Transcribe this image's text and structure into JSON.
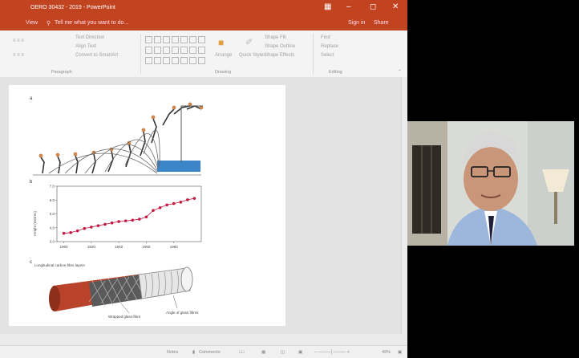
{
  "app": {
    "window_title": "OERO 30432 - 2019 - PowerPoint",
    "sign_in": "Sign in",
    "share": "Share",
    "tabs": [
      "View",
      "Tell me what you want to do..."
    ]
  },
  "ribbon": {
    "paragraph": {
      "group_label": "Paragraph",
      "text_direction": "Text Direction",
      "align_text": "Align Text",
      "convert_smartart": "Convert to SmartArt"
    },
    "drawing": {
      "group_label": "Drawing",
      "arrange": "Arrange",
      "quick_styles": "Quick Styles",
      "shape_fill": "Shape Fill",
      "shape_outline": "Shape Outline",
      "shape_effects": "Shape Effects"
    },
    "editing": {
      "group_label": "Editing",
      "find": "Find",
      "replace": "Replace",
      "select": "Select"
    }
  },
  "slide": {
    "panel_a": "a",
    "panel_b": "b",
    "panel_c": "c",
    "chart_ylabel": "Height (metres)",
    "annotation_label": "Longitudinal carbon-fibre layers",
    "annotation_glass": "Wrapped glass-fibre",
    "annotation_fibres": "Angle of glass fibres"
  },
  "status": {
    "notes": "Notes",
    "comments": "Comments",
    "zoom": "49%"
  },
  "chart_data": {
    "type": "scatter",
    "title": "",
    "xlabel": "",
    "ylabel": "Height (metres)",
    "x": [
      1900,
      1905,
      1910,
      1915,
      1920,
      1925,
      1930,
      1935,
      1940,
      1945,
      1950,
      1955,
      1960,
      1965,
      1970,
      1975,
      1980,
      1985,
      1990,
      1995
    ],
    "values": [
      3.6,
      3.65,
      3.78,
      3.95,
      4.05,
      4.15,
      4.25,
      4.35,
      4.45,
      4.5,
      4.55,
      4.62,
      4.78,
      5.25,
      5.45,
      5.65,
      5.75,
      5.85,
      6.02,
      6.12
    ],
    "xticks": [
      "1900",
      "1920",
      "1940",
      "1960",
      "1980"
    ],
    "yticks": [
      "3.0",
      "4.0",
      "5.0",
      "6.0",
      "7.0"
    ],
    "xlim": [
      1895,
      2000
    ],
    "ylim": [
      3.0,
      7.0
    ],
    "colors": {
      "points": "#c2193f",
      "line": "#c2193f"
    }
  }
}
